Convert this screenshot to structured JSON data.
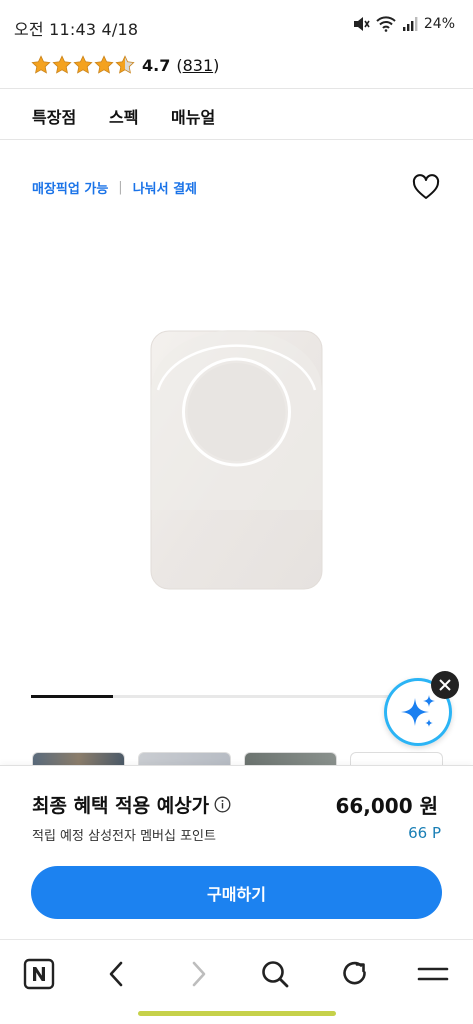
{
  "status_bar": {
    "time": "오전 11:43  4/18",
    "battery": "24%",
    "icons": [
      "mute-icon",
      "wifi-icon",
      "signal-icon"
    ]
  },
  "rating": {
    "stars": 4.5,
    "score": "4.7",
    "count_open": "(",
    "count": "831",
    "count_close": ")",
    "star_color": "#f4a21f"
  },
  "tabs": [
    "특장점",
    "스펙",
    "매뉴얼"
  ],
  "pickup": {
    "store_pickup": "매장픽업 가능",
    "separator": "|",
    "split_pay": "나눠서 결제"
  },
  "carousel": {
    "progress": 0.2
  },
  "price_panel": {
    "title": "최종 혜택 적용 예상가",
    "price": "66,000 원",
    "points_label": "적립 예정 삼성전자 멤버십 포인트",
    "points_value": "66 P",
    "buy_label": "구매하기",
    "accent_color": "#1c82f0"
  },
  "toolbar": {
    "icons": [
      "naver-home-icon",
      "back-icon",
      "forward-icon",
      "search-icon",
      "refresh-icon",
      "menu-icon"
    ]
  }
}
